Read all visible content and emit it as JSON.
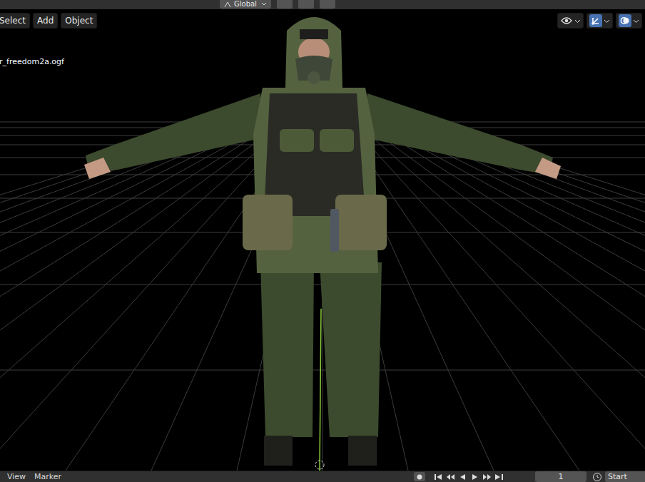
{
  "top_bar": {
    "transform_orientation": "Global"
  },
  "menu": [
    {
      "label": "Select"
    },
    {
      "label": "Add"
    },
    {
      "label": "Object"
    }
  ],
  "header_toggles": [
    {
      "name": "visibility",
      "selected": false
    },
    {
      "name": "gizmos",
      "selected": true
    },
    {
      "name": "overlays",
      "selected": true
    }
  ],
  "viewport": {
    "object_name": "r_freedom2a.ogf"
  },
  "timeline": {
    "menus": [
      "View",
      "Marker"
    ],
    "current_frame": "1",
    "start_label": "Start"
  }
}
